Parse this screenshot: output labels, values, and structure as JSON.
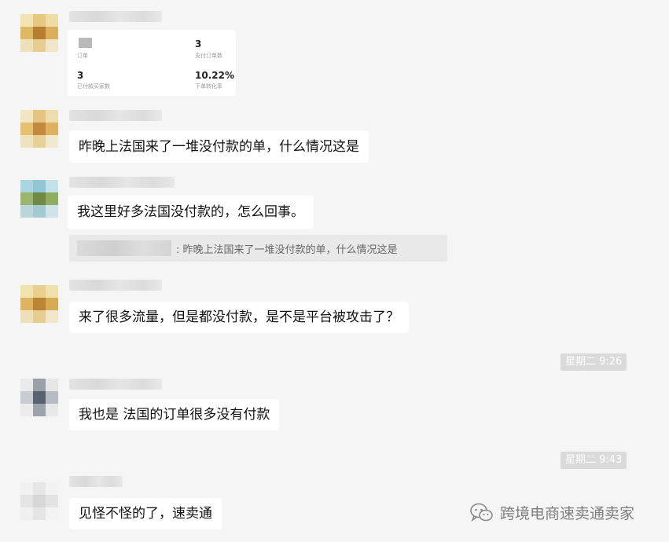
{
  "stats_card": {
    "items": [
      {
        "value": "",
        "label": "订单"
      },
      {
        "value": "3",
        "label": "支付订单数"
      },
      {
        "value": "3",
        "label": "已付款买家数"
      },
      {
        "value": "10.22%",
        "label": "下单转化率"
      }
    ]
  },
  "messages": [
    {
      "text": "昨晚上法国来了一堆没付款的单，什么情况这是"
    },
    {
      "text": "我这里好多法国没付款的，怎么回事。",
      "quote": ": 昨晚上法国来了一堆没付款的单，什么情况这是"
    },
    {
      "text": "来了很多流量，但是都没付款，是不是平台被攻击了？"
    },
    {
      "text": "我也是 法国的订单很多没有付款"
    },
    {
      "text": "见怪不怪的了，速卖通"
    }
  ],
  "timestamps": [
    "星期二 9:26",
    "星期二 9:43"
  ],
  "watermark": {
    "text": "跨境电商速卖通卖家",
    "icon": "wechat-icon"
  },
  "colors": {
    "background": "#f5f5f5",
    "bubble": "#ffffff",
    "timestamp_bg": "#dadada"
  }
}
